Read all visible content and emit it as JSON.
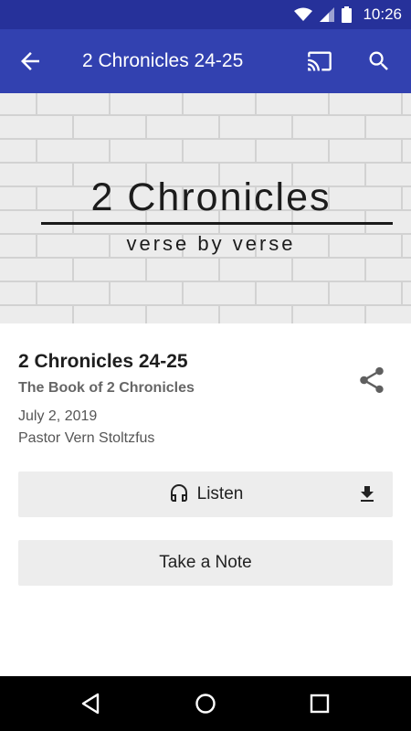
{
  "status_bar": {
    "time": "10:26",
    "icons": [
      "wifi-icon",
      "cell-signal-icon",
      "battery-icon"
    ]
  },
  "app_bar": {
    "title": "2 Chronicles 24-25",
    "icons": [
      "arrow-back-icon",
      "cast-icon",
      "search-icon"
    ]
  },
  "banner": {
    "title": "2 Chronicles",
    "subtitle": "verse by verse"
  },
  "sermon": {
    "title": "2 Chronicles 24-25",
    "series": "The Book of 2 Chronicles",
    "date": "July 2, 2019",
    "speaker": "Pastor Vern Stoltzfus",
    "share_icon": "share-icon"
  },
  "actions": {
    "listen_label": "Listen",
    "listen_icon": "headphones-icon",
    "download_icon": "download-icon",
    "note_label": "Take a Note"
  },
  "nav_bar": {
    "icons": [
      "back-triangle-icon",
      "home-circle-icon",
      "recents-square-icon"
    ]
  },
  "colors": {
    "status_bar": "#26319a",
    "app_bar": "#3241b0",
    "button_bg": "#ededed"
  }
}
